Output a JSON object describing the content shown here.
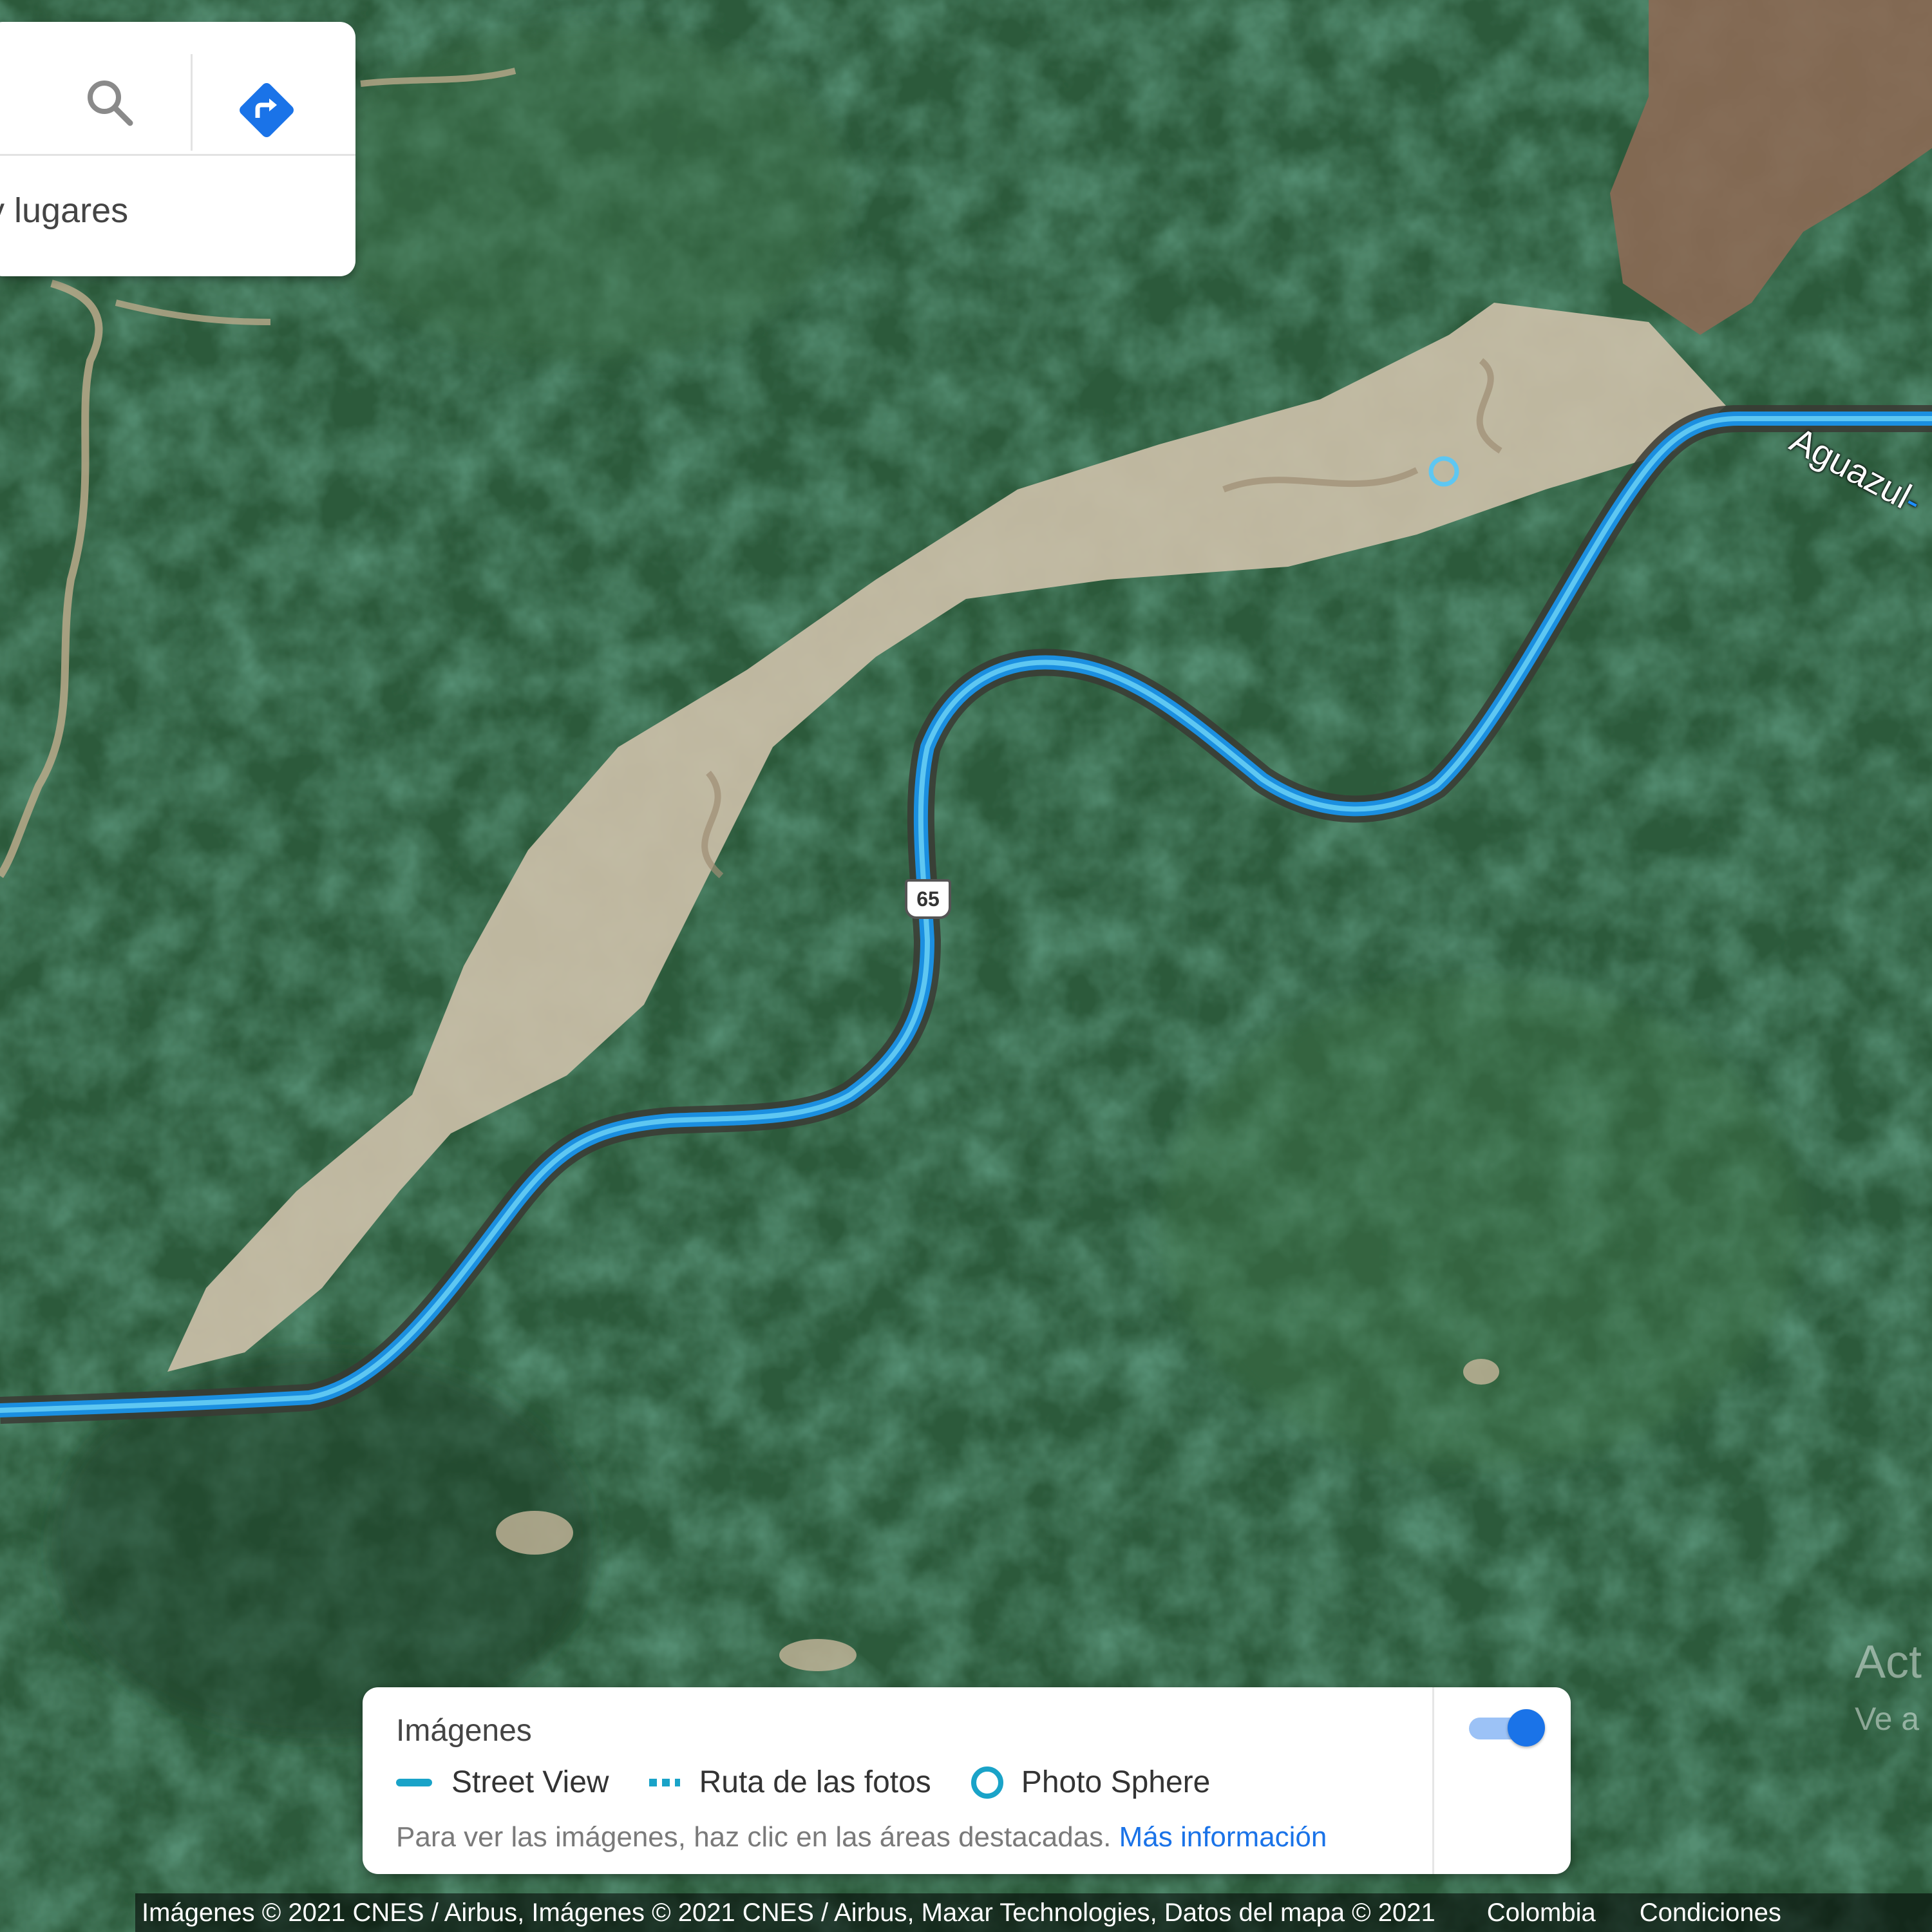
{
  "search": {
    "hint": "y lugares"
  },
  "map": {
    "road_label": "Aguazul",
    "road_label_tail": "-",
    "route_number": "65",
    "route_color": "#1aa3c8"
  },
  "legend": {
    "title": "Imágenes",
    "items": [
      {
        "symbol": "solid-line",
        "label": "Street View"
      },
      {
        "symbol": "dotted-line",
        "label": "Ruta de las fotos"
      },
      {
        "symbol": "ring",
        "label": "Photo Sphere"
      }
    ],
    "note": "Para ver las imágenes, haz clic en las áreas destacadas.",
    "link": "Más información",
    "toggle_on": true,
    "accent_color": "#1a73e8"
  },
  "watermark": {
    "line1": "Act",
    "line2": "Ve a"
  },
  "attribution": {
    "text": "Imágenes © 2021 CNES / Airbus, Imágenes © 2021 CNES / Airbus, Maxar Technologies, Datos del mapa © 2021",
    "region": "Colombia",
    "terms": "Condiciones"
  }
}
